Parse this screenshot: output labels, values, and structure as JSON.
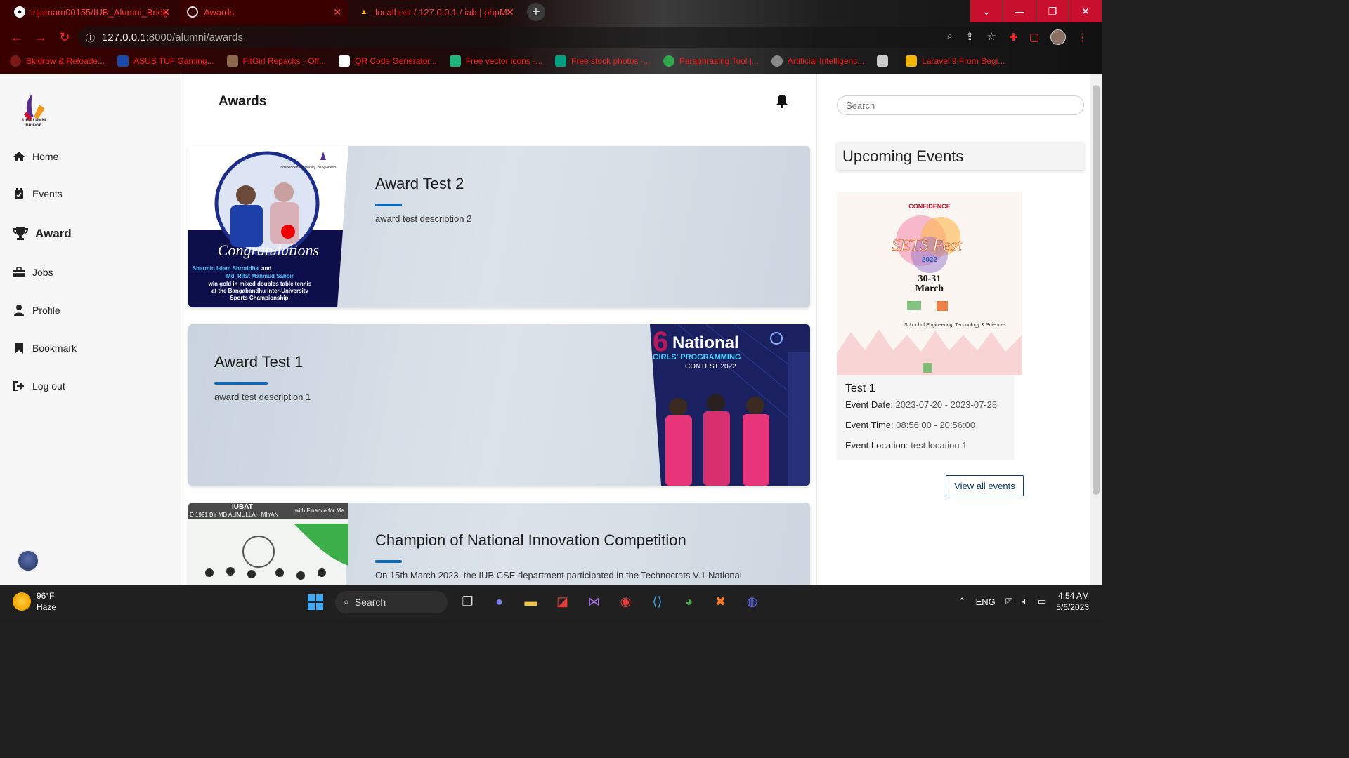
{
  "browser": {
    "tabs": [
      {
        "title": "injamam00155/IUB_Alumni_Bridg",
        "icon": "github-icon"
      },
      {
        "title": "Awards",
        "icon": "globe-icon"
      },
      {
        "title": "localhost / 127.0.0.1 / iab | phpM",
        "icon": "phpmyadmin-icon"
      }
    ],
    "address_host": "127.0.0.1",
    "address_path": ":8000/alumni/awards",
    "bookmarks": [
      {
        "label": "Skidrow & Reloade...",
        "color": "#7a1a1a"
      },
      {
        "label": "ASUS TUF Gaming...",
        "color": "#1a4aa8"
      },
      {
        "label": "FitGirl Repacks - Off...",
        "color": "#8a6a4a"
      },
      {
        "label": "QR Code Generator...",
        "color": "#ffffff"
      },
      {
        "label": "Free vector icons -...",
        "color": "#1fb57a"
      },
      {
        "label": "Free stock photos -...",
        "color": "#05a081"
      },
      {
        "label": "Paraphrasing Tool |...",
        "color": "#2ea84a"
      },
      {
        "label": "Artificial Intelligenc...",
        "color": "#888888"
      },
      {
        "label": "",
        "color": "#cccccc"
      },
      {
        "label": "Laravel 9 From Begi...",
        "color": "#f2b600"
      }
    ]
  },
  "sidebar": {
    "logo_text": "IUB ALUMNI BRIDGE",
    "items": [
      {
        "label": "Home",
        "icon": "home-icon"
      },
      {
        "label": "Events",
        "icon": "calendar-icon"
      },
      {
        "label": "Award",
        "icon": "trophy-icon"
      },
      {
        "label": "Jobs",
        "icon": "briefcase-icon"
      },
      {
        "label": "Profile",
        "icon": "user-icon"
      },
      {
        "label": "Bookmark",
        "icon": "bookmark-icon"
      },
      {
        "label": "Log out",
        "icon": "logout-icon"
      }
    ]
  },
  "main": {
    "title": "Awards",
    "awards": [
      {
        "title": "Award Test 2",
        "description": "award test description 2",
        "image_text": {
          "headline": "Congratulations",
          "names1": "Sharmin Islam Shroddha",
          "and": "and",
          "names2": "Md. Rifat Mahmud Sabbir",
          "line3": "win gold in mixed doubles table tennis",
          "line4": "at the Bangabandhu Inter-University",
          "line5": "Sports Championship.",
          "uni": "Independent University, Bangladesh"
        }
      },
      {
        "title": "Award Test 1",
        "description": "award test description 1",
        "image_text": {
          "big": "National",
          "line2": "GIRLS' PROGRAMMING",
          "line3": "CONTEST 2022"
        }
      },
      {
        "title": "Champion of National Innovation Competition",
        "description": "On 15th March 2023, the IUB CSE department participated in the Technocrats V.1 National",
        "image_text": {
          "top": "IUBAT",
          "banner": "D 1991 BY MD ALIMULLAH MIYAN",
          "right": "with Finance for Me"
        }
      }
    ]
  },
  "right": {
    "search_placeholder": "Search",
    "upcoming_title": "Upcoming Events",
    "event": {
      "title": "Test 1",
      "date_label": "Event Date:",
      "date_value": "2023-07-20 - 2023-07-28",
      "time_label": "Event Time:",
      "time_value": "08:56:00 - 20:56:00",
      "location_label": "Event Location:",
      "location_value": "test location 1",
      "image_text": {
        "brand": "CONFIDENCE",
        "fest": "SETS Fest",
        "year": "2022",
        "dates": "30-31",
        "month": "March",
        "school": "School of Engineering, Technology & Sciences"
      }
    },
    "view_all": "View all events"
  },
  "taskbar": {
    "temperature": "96°F",
    "weather": "Haze",
    "search": "Search",
    "lang": "ENG",
    "time": "4:54 AM",
    "date": "5/6/2023"
  },
  "colors": {
    "accent_bar": "#1266b3",
    "chrome_red": "#ff2020",
    "window_ctl": "#c8102e"
  }
}
